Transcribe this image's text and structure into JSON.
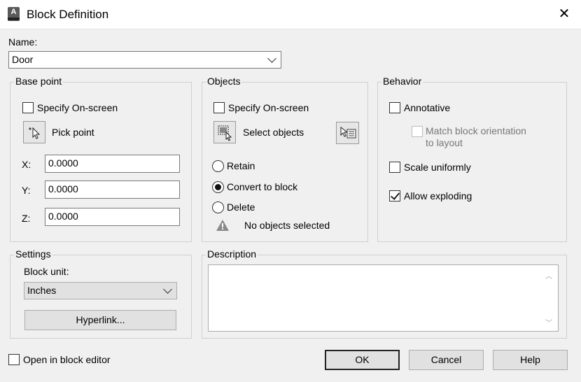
{
  "window": {
    "title": "Block Definition",
    "app_icon_letter": "A"
  },
  "name": {
    "label": "Name:",
    "value": "Door"
  },
  "base_point": {
    "legend": "Base point",
    "specify_on_screen": {
      "label": "Specify On-screen",
      "checked": false
    },
    "pick_point_label": "Pick point",
    "x_label": "X:",
    "x_value": "0.0000",
    "y_label": "Y:",
    "y_value": "0.0000",
    "z_label": "Z:",
    "z_value": "0.0000"
  },
  "objects": {
    "legend": "Objects",
    "specify_on_screen": {
      "label": "Specify On-screen",
      "checked": false
    },
    "select_objects_label": "Select objects",
    "retain_label": "Retain",
    "convert_label": "Convert to block",
    "delete_label": "Delete",
    "selected_option": "Convert to block",
    "status": "No objects selected"
  },
  "behavior": {
    "legend": "Behavior",
    "annotative": {
      "label": "Annotative",
      "checked": false
    },
    "match_orientation": {
      "label_line1": "Match block orientation",
      "label_line2": "to layout",
      "checked": false,
      "enabled": false
    },
    "scale_uniformly": {
      "label": "Scale uniformly",
      "checked": false
    },
    "allow_exploding": {
      "label": "Allow exploding",
      "checked": true
    }
  },
  "settings": {
    "legend": "Settings",
    "block_unit_label": "Block unit:",
    "block_unit_value": "Inches",
    "hyperlink_label": "Hyperlink..."
  },
  "description": {
    "legend": "Description",
    "value": ""
  },
  "footer": {
    "open_in_editor": {
      "label": "Open in block editor",
      "checked": false
    },
    "ok_label": "OK",
    "cancel_label": "Cancel",
    "help_label": "Help"
  }
}
